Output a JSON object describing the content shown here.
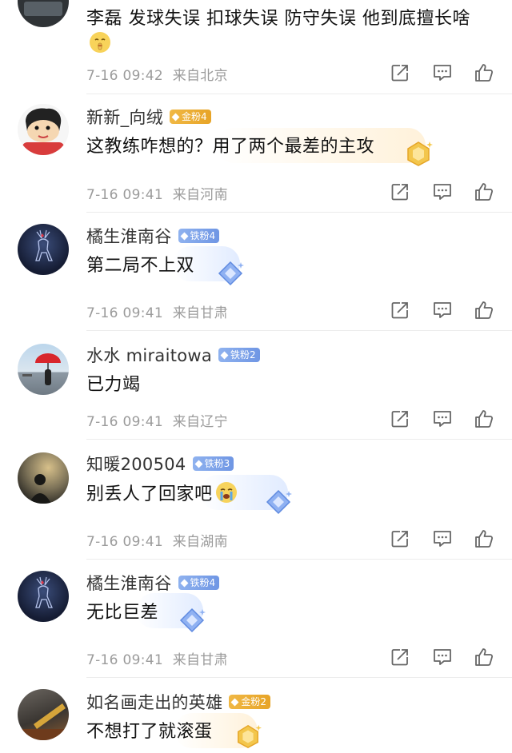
{
  "comments": [
    {
      "username": "",
      "text": "李磊 发球失误 扣球失误 防守失误 他到底擅长啥",
      "time": "7-16 09:42",
      "location": "来自北京",
      "avatar_icon": "avatar-dark-photo",
      "emoji": "shush-face-emoji"
    },
    {
      "username": "新新_向绒",
      "badge": "金粉4",
      "badge_type": "gold",
      "text": "这教练咋想的？用了两个最差的主攻",
      "time": "7-16 09:41",
      "location": "来自河南",
      "avatar_icon": "cartoon-boy-avatar"
    },
    {
      "username": "橘生淮南谷",
      "badge": "铁粉4",
      "badge_type": "iron",
      "text": "第二局不上双",
      "time": "7-16 09:41",
      "location": "来自甘肃",
      "avatar_icon": "deer-night-avatar"
    },
    {
      "username": "水水 miraitowa",
      "badge": "铁粉2",
      "badge_type": "iron",
      "text": "已力竭",
      "time": "7-16 09:41",
      "location": "来自辽宁",
      "avatar_icon": "red-umbrella-beach-avatar"
    },
    {
      "username": "知暖200504",
      "badge": "铁粉3",
      "badge_type": "iron",
      "text": "别丢人了回家吧",
      "time": "7-16 09:41",
      "location": "来自湖南",
      "avatar_icon": "sunset-silhouette-avatar",
      "emoji": "crying-face-emoji"
    },
    {
      "username": "橘生淮南谷",
      "badge": "铁粉4",
      "badge_type": "iron",
      "text": "无比巨差",
      "time": "7-16 09:41",
      "location": "来自甘肃",
      "avatar_icon": "deer-night-avatar"
    },
    {
      "username": "如名画走出的英雄",
      "badge": "金粉2",
      "badge_type": "gold",
      "text": "不想打了就滚蛋",
      "avatar_icon": "dark-object-avatar"
    }
  ],
  "icons": {
    "share": "share-icon",
    "comment": "comment-icon",
    "like": "like-icon"
  },
  "colors": {
    "gold_badge": "#e9aa2c",
    "iron_badge": "#7aa0e8",
    "meta_text": "#9b9b9b"
  }
}
